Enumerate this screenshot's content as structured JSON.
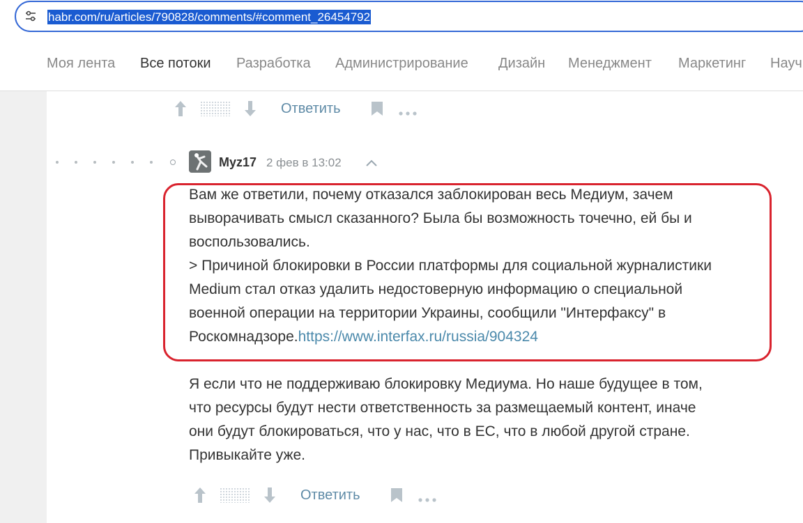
{
  "address_bar": {
    "url": "habr.com/ru/articles/790828/comments/#comment_26454792",
    "site_info_icon": "tune-icon"
  },
  "nav": {
    "items": [
      "Моя лента",
      "Все потоки",
      "Разработка",
      "Администрирование",
      "Дизайн",
      "Менеджмент",
      "Маркетинг",
      "Науч"
    ],
    "active": "Все потоки"
  },
  "prev_comment": {
    "reply_label": "Ответить"
  },
  "comment": {
    "author": "Myz17",
    "timestamp": "2 фев в 13:02",
    "quoted_block": {
      "lines": [
        "Вам же ответили, почему отказался заблокирован весь Медиум, зачем",
        "выворачивать смысл сказанного? Была бы возможность точечно, ей бы и",
        "воспользовались.",
        "> Причиной блокировки в России платформы для социальной журналистики",
        "Medium стал отказ удалить недостоверную информацию о специальной",
        "военной операции на территории Украины, сообщили \"Интерфаксу\" в"
      ],
      "last_line_text": "Роскомнадзоре.",
      "link": "https://www.interfax.ru/russia/904324"
    },
    "body_lines": [
      "Я если что не поддерживаю блокировку Медиума. Но наше будущее в том,",
      "что ресурсы будут нести ответственность за размещаемый контент, иначе",
      "они будут блокироваться, что у нас, что в ЕС, что в любой другой стране.",
      "Привыкайте уже."
    ],
    "reply_label": "Ответить"
  },
  "colors": {
    "address_border": "#3367d6",
    "url_selection": "#1a5bd1",
    "highlight_border": "#d9232e",
    "link": "#4b89ab",
    "reply_link": "#5e8aa6"
  }
}
